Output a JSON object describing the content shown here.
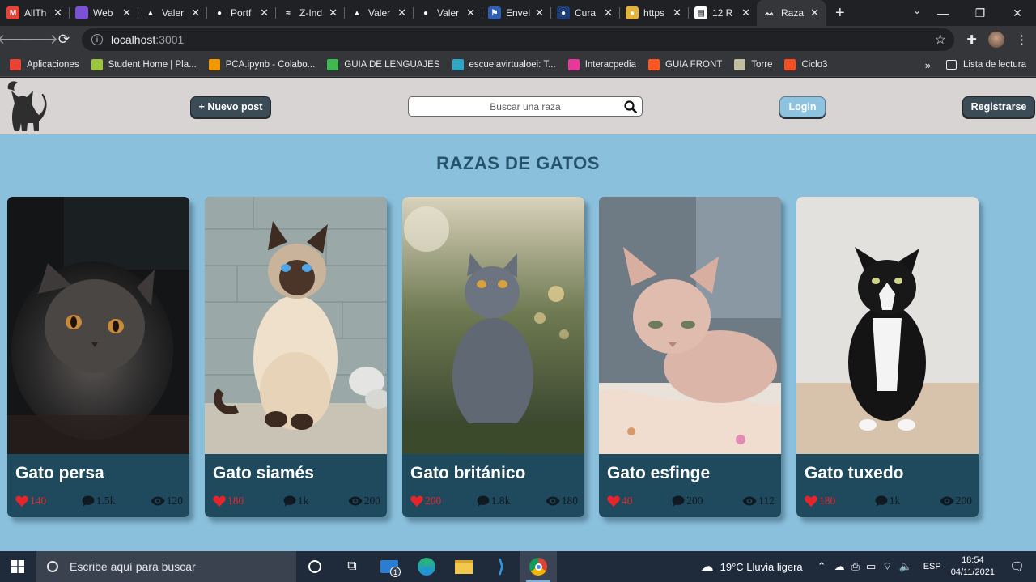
{
  "browser": {
    "tabs": [
      {
        "title": "AllTh",
        "fav_text": "M",
        "fav_color": "#ea4335",
        "active": false
      },
      {
        "title": "Web",
        "fav_text": "",
        "fav_color": "#7b52d6",
        "active": false
      },
      {
        "title": "Valer",
        "fav_text": "▲",
        "fav_color": "#202124",
        "active": false
      },
      {
        "title": "Portf",
        "fav_text": "●",
        "fav_color": "#202124",
        "active": false
      },
      {
        "title": "Z-Ind",
        "fav_text": "≈",
        "fav_color": "#202124",
        "active": false
      },
      {
        "title": "Valer",
        "fav_text": "▲",
        "fav_color": "#202124",
        "active": false
      },
      {
        "title": "Valer",
        "fav_text": "●",
        "fav_color": "#202124",
        "active": false
      },
      {
        "title": "Envel",
        "fav_text": "⚑",
        "fav_color": "#2f5fb3",
        "active": false
      },
      {
        "title": "Cura",
        "fav_text": "●",
        "fav_color": "#1c3d78",
        "active": false
      },
      {
        "title": "https",
        "fav_text": "●",
        "fav_color": "#e2b33c",
        "active": false
      },
      {
        "title": "12 R",
        "fav_text": "▤",
        "fav_color": "#ffffff",
        "active": false
      },
      {
        "title": "Raza",
        "fav_text": "ᨐ",
        "fav_color": "#35363a",
        "active": true
      }
    ],
    "close_glyph": "✕",
    "newtab_glyph": "+",
    "url_host": "localhost",
    "url_port": ":3001"
  },
  "bookmarks": [
    {
      "label": "Aplicaciones",
      "color": "#ea4335"
    },
    {
      "label": "Student Home | Pla...",
      "color": "#9bc53d"
    },
    {
      "label": "PCA.ipynb - Colabo...",
      "color": "#f29900"
    },
    {
      "label": "GUIA DE LENGUAJES",
      "color": "#3fb950"
    },
    {
      "label": "escuelavirtualoei: T...",
      "color": "#2ea7c7"
    },
    {
      "label": "Interacpedia",
      "color": "#e6399b"
    },
    {
      "label": "GUIA FRONT",
      "color": "#ff5722"
    },
    {
      "label": "Torre",
      "color": "#c0c0a0"
    },
    {
      "label": "Ciclo3",
      "color": "#f24e1e"
    }
  ],
  "bookmarks_more": "»",
  "reading_list": "Lista de lectura",
  "header": {
    "new_post": "+ Nuevo post",
    "search_placeholder": "Buscar una raza",
    "login": "Login",
    "register": "Registrarse"
  },
  "heading": "RAZAS DE GATOS",
  "cards": [
    {
      "name": "Gato persa",
      "likes": "140",
      "comments": "1.5k",
      "views": "120"
    },
    {
      "name": "Gato siamés",
      "likes": "180",
      "comments": "1k",
      "views": "200"
    },
    {
      "name": "Gato británico",
      "likes": "200",
      "comments": "1.8k",
      "views": "180"
    },
    {
      "name": "Gato esfinge",
      "likes": "40",
      "comments": "200",
      "views": "112"
    },
    {
      "name": "Gato tuxedo",
      "likes": "180",
      "comments": "1k",
      "views": "200"
    }
  ],
  "taskbar": {
    "search_placeholder": "Escribe aquí para buscar",
    "weather": "19°C  Lluvia ligera",
    "lang": "ESP",
    "time": "18:54",
    "date": "04/11/2021",
    "mail_badge": "1"
  },
  "colors": {
    "page_bg": "#8bc0dc",
    "card_info_bg": "#1f4a5e",
    "heading": "#24536b",
    "like": "#e8242a"
  }
}
